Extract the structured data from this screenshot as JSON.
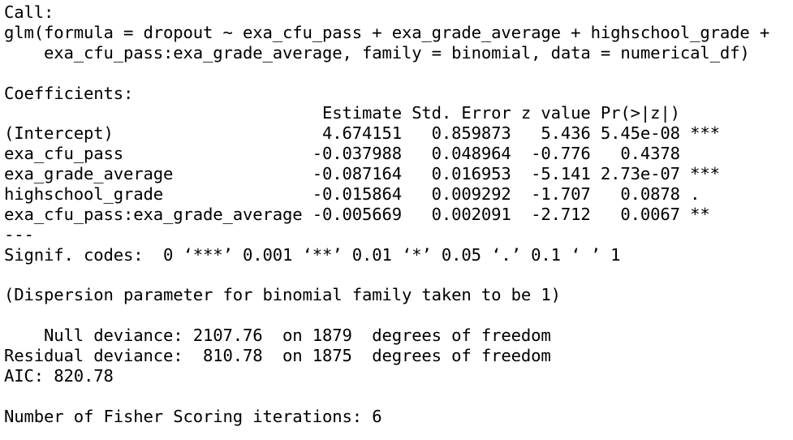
{
  "console": {
    "lines": [
      "Call:",
      "glm(formula = dropout ~ exa_cfu_pass + exa_grade_average + highschool_grade + ",
      "    exa_cfu_pass:exa_grade_average, family = binomial, data = numerical_df)",
      "",
      "Coefficients:",
      "                                Estimate Std. Error z value Pr(>|z|)    ",
      "(Intercept)                     4.674151   0.859873   5.436 5.45e-08 ***",
      "exa_cfu_pass                   -0.037988   0.048964  -0.776   0.4378    ",
      "exa_grade_average              -0.087164   0.016953  -5.141 2.73e-07 ***",
      "highschool_grade               -0.015864   0.009292  -1.707   0.0878 .  ",
      "exa_cfu_pass:exa_grade_average -0.005669   0.002091  -2.712   0.0067 ** ",
      "---",
      "Signif. codes:  0 ‘***’ 0.001 ‘**’ 0.01 ‘*’ 0.05 ‘.’ 0.1 ‘ ’ 1",
      "",
      "(Dispersion parameter for binomial family taken to be 1)",
      "",
      "    Null deviance: 2107.76  on 1879  degrees of freedom",
      "Residual deviance:  810.78  on 1875  degrees of freedom",
      "AIC: 820.78",
      "",
      "Number of Fisher Scoring iterations: 6"
    ]
  }
}
